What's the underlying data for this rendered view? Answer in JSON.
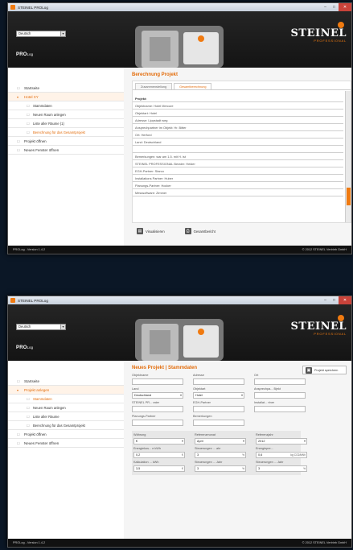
{
  "window1": {
    "title": "STEINEL PROLog",
    "language": "Deutsch",
    "logo": {
      "brand": "STEINEL",
      "sub": "PROFESSIONAL"
    },
    "prolog_label": "PRO",
    "prolog_sub": "Log",
    "sidebar": [
      {
        "label": "Startseite",
        "kind": "top"
      },
      {
        "label": "Hotel XY",
        "kind": "active"
      },
      {
        "label": "Stammdaten",
        "kind": "sub"
      },
      {
        "label": "Neuen Raum anlegen",
        "kind": "sub"
      },
      {
        "label": "Liste aller Räume (1)",
        "kind": "sub"
      },
      {
        "label": "Berechnung für das Gesamtprojekt",
        "kind": "sel"
      },
      {
        "label": "Projekt öffnen",
        "kind": "top"
      },
      {
        "label": "Neues Fenster öffnen",
        "kind": "top"
      }
    ],
    "page_title": "Berechnung Projekt",
    "tabs": [
      "Zusammenstellung",
      "Gesamtberechnung"
    ],
    "report_header": "Projekt:",
    "report_rows": [
      "Objektname: Hotel Mercure",
      "Objektart: Hotel",
      "Adresse: Lippstadt weg",
      "Ansprechpartner im Objekt: Hr. Bitter",
      "Ort: Herford",
      "Land: Deutschland",
      "",
      "Bemerkungen: war am 1.5. mit H. ist",
      "STEINEL PROFESSIONAL Berater: Heider",
      "EGH-Partner: Starco",
      "Installations Partner: Huber",
      "Planungs-Partner: Hocker",
      "Messsoftware: Zimmer"
    ],
    "actions": [
      "Visualisieren",
      "Gesamtbericht"
    ],
    "status_left": "PROLog - Version 1.4.2",
    "status_right": "© 2012 STEINEL Vertrieb GmbH"
  },
  "window2": {
    "title": "STEINEL PROLog",
    "language": "Deutsch",
    "logo": {
      "brand": "STEINEL",
      "sub": "PROFESSIONAL"
    },
    "prolog_label": "PRO",
    "prolog_sub": "Log",
    "sidebar": [
      {
        "label": "Startseite",
        "kind": "top"
      },
      {
        "label": "Projekt anlegen",
        "kind": "active"
      },
      {
        "label": "Stammdaten",
        "kind": "sel"
      },
      {
        "label": "Neuen Raum anlegen",
        "kind": "sub"
      },
      {
        "label": "Liste aller Räume",
        "kind": "sub"
      },
      {
        "label": "Berechnung für das Gesamtprojekt",
        "kind": "sub"
      },
      {
        "label": "Projekt öffnen",
        "kind": "top"
      },
      {
        "label": "Neues Fenster öffnen",
        "kind": "top"
      }
    ],
    "page_title": "Neues Projekt | Stammdaten",
    "save_button": "Projekt speichern",
    "fields_top": [
      {
        "label": "Objektname",
        "value": "",
        "type": "text"
      },
      {
        "label": "Adresse",
        "value": "",
        "type": "text"
      },
      {
        "label": "Ort",
        "value": "",
        "type": "text"
      },
      {
        "label": "Land",
        "value": "Deutschland",
        "type": "select"
      },
      {
        "label": "Objektart",
        "value": "Hotel",
        "type": "select"
      },
      {
        "label": "Ansprechpa... Bjekt",
        "value": "",
        "type": "text"
      },
      {
        "label": "STEINEL PR... rater",
        "value": "",
        "type": "text"
      },
      {
        "label": "EGH-Partner",
        "value": "",
        "type": "text"
      },
      {
        "label": "Installat... rtner",
        "value": "",
        "type": "text"
      },
      {
        "label": "Planungs-Partner",
        "value": "",
        "type": "text"
      },
      {
        "label": "Bemerkungen",
        "value": "",
        "type": "text"
      },
      {
        "label": "",
        "value": "",
        "type": "blank"
      }
    ],
    "fields_bottom": [
      {
        "label": "Währung",
        "value": "€",
        "type": "select",
        "unit": ""
      },
      {
        "label": "Referenzmonat",
        "value": "April",
        "type": "select",
        "unit": ""
      },
      {
        "label": "Referenzjahr",
        "value": "2012",
        "type": "select",
        "unit": ""
      },
      {
        "label": "Energiekos... e kWh",
        "value": "0,2",
        "type": "unit",
        "unit": "€"
      },
      {
        "label": "Steuerungen ... ahr",
        "value": "3",
        "type": "unit",
        "unit": "%"
      },
      {
        "label": "Energiepre...",
        "value": "0,6",
        "type": "unit",
        "unit": "kg CO2/kWh"
      },
      {
        "label": "Kalkulation ... kWh",
        "value": "3,5",
        "type": "unit",
        "unit": "€"
      },
      {
        "label": "Steuerungen ... Jahr",
        "value": "3",
        "type": "unit",
        "unit": "%"
      },
      {
        "label": "Steuerungen ... Jahr",
        "value": "3",
        "type": "unit",
        "unit": "%"
      }
    ],
    "status_left": "PROLog - Version 1.4.2",
    "status_right": "© 2012 STEINEL Vertrieb GmbH"
  },
  "colors": {
    "accent": "#e36d0c",
    "brand_orange": "#f07a10",
    "background": "#0b1726"
  }
}
